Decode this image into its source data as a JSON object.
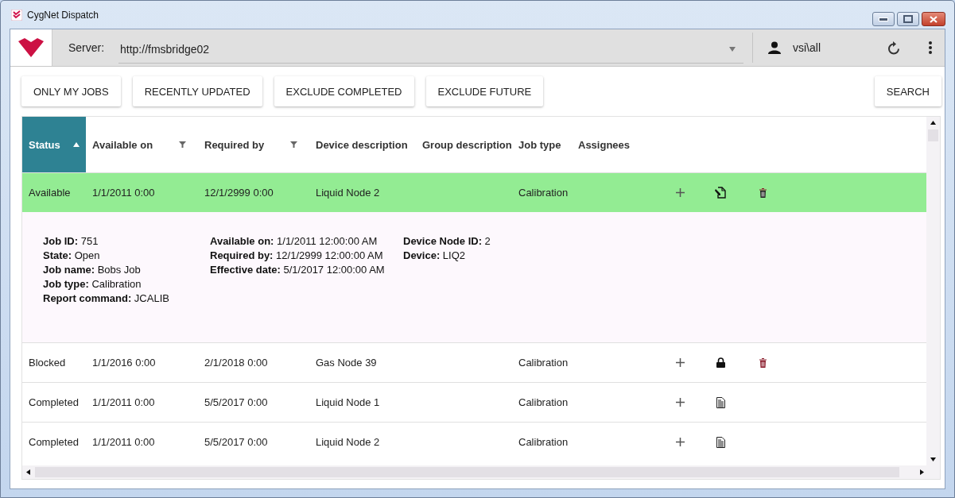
{
  "window": {
    "title": "CygNet Dispatch"
  },
  "toolbar": {
    "server_label": "Server:",
    "server_value": "http://fmsbridge02",
    "user": "vsi\\all"
  },
  "filters": [
    {
      "label": "ONLY MY JOBS"
    },
    {
      "label": "RECENTLY UPDATED"
    },
    {
      "label": "EXCLUDE COMPLETED"
    },
    {
      "label": "EXCLUDE FUTURE"
    }
  ],
  "search_button": "SEARCH",
  "table": {
    "columns": [
      {
        "label": "Status",
        "sorted": true,
        "filter": false
      },
      {
        "label": "Available on",
        "sorted": false,
        "filter": true
      },
      {
        "label": "Required by",
        "sorted": false,
        "filter": true
      },
      {
        "label": "Device description",
        "sorted": false,
        "filter": false
      },
      {
        "label": "Group description",
        "sorted": false,
        "filter": false
      },
      {
        "label": "Job type",
        "sorted": false,
        "filter": false
      },
      {
        "label": "Assignees",
        "sorted": false,
        "filter": false
      }
    ],
    "rows": [
      {
        "cells": [
          "Available",
          "1/1/2011 0:00",
          "12/1/2999 0:00",
          "Liquid Node 2",
          "",
          "Calibration",
          ""
        ],
        "selected": true,
        "kind": "edit",
        "deletable": true,
        "details": [
          [
            "**Job ID:** 751",
            "**State:** Open",
            "**Job name:** Bobs Job",
            "**Job type:** Calibration",
            "**Report command:** JCALIB"
          ],
          [
            "**Available on:** 1/1/2011 12:00:00 AM",
            "**Required by:** 12/1/2999 12:00:00 AM",
            "**Effective date:** 5/1/2017 12:00:00 AM"
          ],
          [
            "**Device Node ID:** 2",
            "**Device:** LIQ2"
          ]
        ]
      },
      {
        "cells": [
          "Blocked",
          "1/1/2016 0:00",
          "2/1/2018 0:00",
          "Gas Node 39",
          "",
          "Calibration",
          ""
        ],
        "selected": false,
        "kind": "lock",
        "deletable": true
      },
      {
        "cells": [
          "Completed",
          "1/1/2011 0:00",
          "5/5/2017 0:00",
          "Liquid Node 1",
          "",
          "Calibration",
          ""
        ],
        "selected": false,
        "kind": "report",
        "deletable": false
      },
      {
        "cells": [
          "Completed",
          "1/1/2011 0:00",
          "5/5/2017 0:00",
          "Liquid Node 2",
          "",
          "Calibration",
          ""
        ],
        "selected": false,
        "kind": "report",
        "deletable": false
      }
    ]
  }
}
